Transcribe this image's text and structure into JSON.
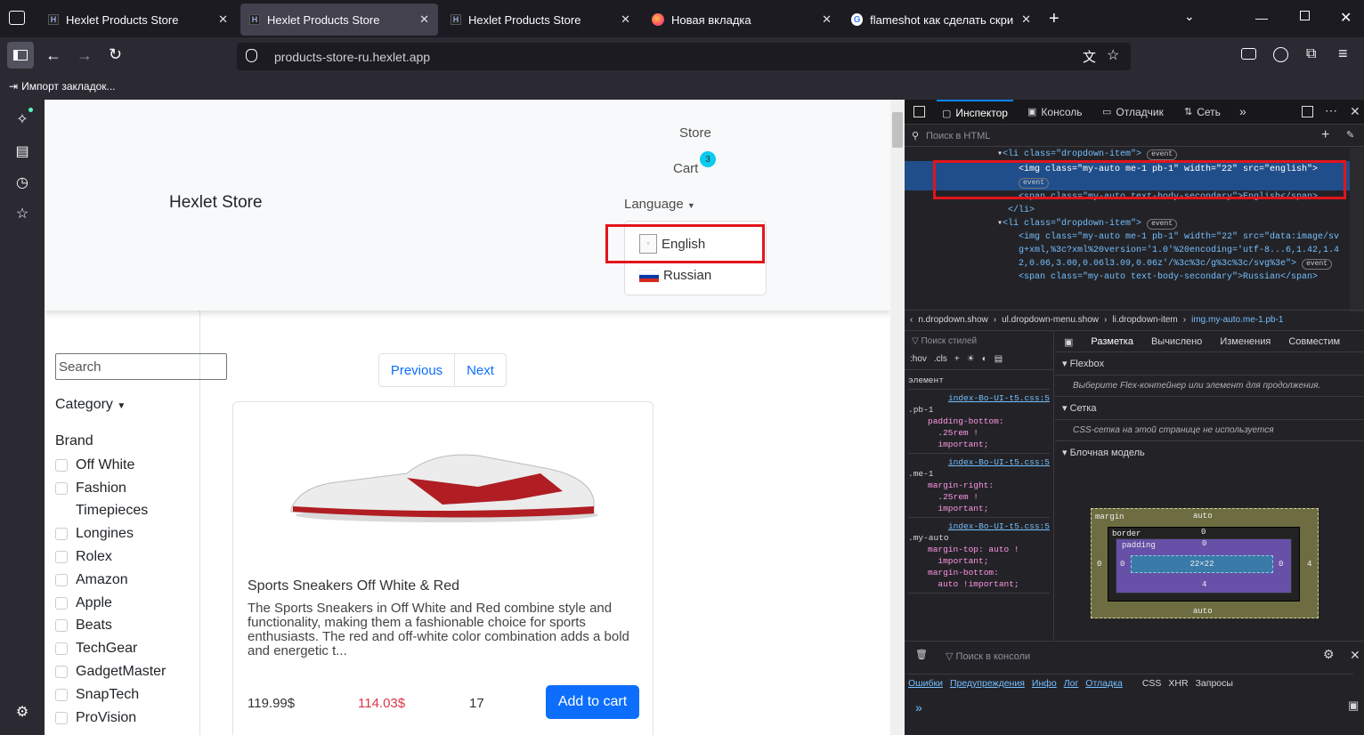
{
  "tabs": [
    {
      "title": "Hexlet Products Store",
      "favicon": "hexlet-icon"
    },
    {
      "title": "Hexlet Products Store",
      "favicon": "hexlet-icon",
      "active": true
    },
    {
      "title": "Hexlet Products Store",
      "favicon": "hexlet-icon"
    },
    {
      "title": "Новая вкладка",
      "favicon": "firefox-icon"
    },
    {
      "title": "flameshot как сделать скринш",
      "favicon": "google-icon"
    }
  ],
  "nav": {
    "url": "products-store-ru.hexlet.app"
  },
  "bookmarks": {
    "import_label": "Импорт закладок..."
  },
  "site": {
    "brand": "Hexlet Store",
    "store_link": "Store",
    "cart_link": "Cart",
    "cart_count": "3",
    "language_label": "Language",
    "languages": [
      "English",
      "Russian"
    ],
    "search_placeholder": "Search",
    "category_label": "Category",
    "brand_label": "Brand",
    "brands": [
      "Off White",
      "Fashion",
      "Timepieces",
      "Longines",
      "Rolex",
      "Amazon",
      "Apple",
      "Beats",
      "TechGear",
      "GadgetMaster",
      "SnapTech",
      "ProVision"
    ],
    "prev": "Previous",
    "next": "Next",
    "product": {
      "title": "Sports Sneakers Off White & Red",
      "description": "The Sports Sneakers in Off White and Red combine style and functionality, making them a fashionable choice for sports enthusiasts. The red and off-white color combination adds a bold and energetic t...",
      "price": "119.99$",
      "sale_price": "114.03$",
      "stock": "17",
      "add_to_cart": "Add to cart"
    }
  },
  "devtools": {
    "tabs": [
      "Инспектор",
      "Консоль",
      "Отладчик",
      "Сеть"
    ],
    "html_search": "Поиск в HTML",
    "html_lines": [
      "<li class=\"dropdown-item\">",
      "<img class=\"my-auto me-1 pb-1\" width=\"22\" src=\"english\">",
      "<span class=\"my-auto text-body-secondary\">English</span>",
      "</li>",
      "<li class=\"dropdown-item\">",
      "<img class=\"my-auto me-1 pb-1\" width=\"22\" src=\"data:image/svg+xml,%3c?xml%20version='1.0'%20encoding='utf-8...6,1.42,1.42,0.06,3.00,0.06l3.09,0.06z'/%3c%3c/g%3c%3c/svg%3e\">",
      "<span class=\"my-auto text-body-secondary\">Russian</span>"
    ],
    "event_badge": "event",
    "breadcrumbs": [
      "n.dropdown.show",
      "ul.dropdown-menu.show",
      "li.dropdown-item",
      "img.my-auto.me-1.pb-1"
    ],
    "styles_search": "Поиск стилей",
    "pseudo": ":hov",
    "cls": ".cls",
    "rules": [
      {
        "selector": "элемент",
        "source": "",
        "props": []
      },
      {
        "selector": ".pb-1",
        "source": "index-Bo-UI-t5.css:5",
        "props": [
          "padding-bottom:",
          "  .25rem !",
          "  important;"
        ]
      },
      {
        "selector": ".me-1",
        "source": "index-Bo-UI-t5.css:5",
        "props": [
          "margin-right:",
          "  .25rem !",
          "  important;"
        ]
      },
      {
        "selector": ".my-auto",
        "source": "index-Bo-UI-t5.css:5",
        "props": [
          "margin-top: auto !",
          "  important;",
          "margin-bottom:",
          "  auto !important;"
        ]
      }
    ],
    "layout_tabs": [
      "Разметка",
      "Вычислено",
      "Изменения",
      "Совместим"
    ],
    "flexbox": "Flexbox",
    "flexbox_hint": "Выберите Flex-контейнер или элемент для продолжения.",
    "grid": "Сетка",
    "grid_hint": "CSS-сетка на этой странице не используется",
    "boxmodel": "Блочная модель",
    "box": {
      "margin": "margin",
      "margin_top": "auto",
      "margin_bottom": "auto",
      "margin_left": "0",
      "margin_right": "4",
      "border": "border",
      "border_val": "0",
      "padding": "padding",
      "padding_top": "0",
      "padding_bottom": "4",
      "padding_left": "0",
      "padding_right": "0",
      "size": "22×22"
    },
    "console_search": "Поиск в консоли",
    "filters": [
      "Ошибки",
      "Предупреждения",
      "Инфо",
      "Лог",
      "Отладка",
      "CSS",
      "XHR",
      "Запросы"
    ]
  }
}
